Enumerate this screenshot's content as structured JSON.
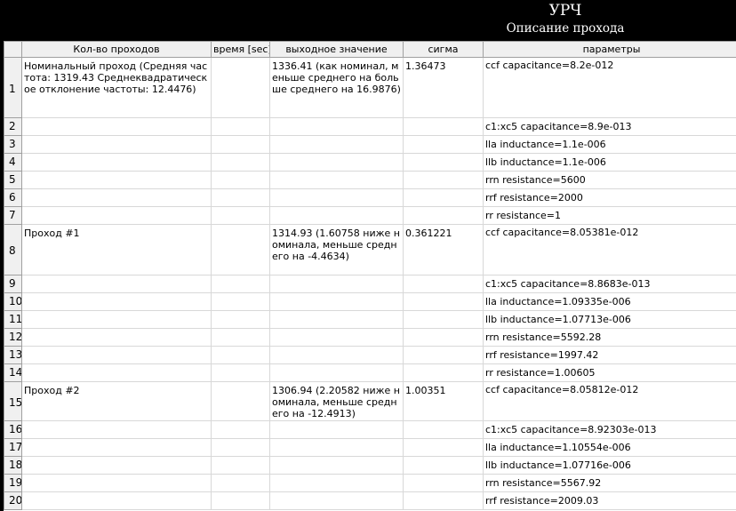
{
  "window": {
    "title": "УРЧ",
    "subtitle": "Описание прохода"
  },
  "columns": [
    "",
    "Кол-во проходов",
    "время [sec]",
    "выходное значение",
    "сигма",
    "параметры"
  ],
  "rows": [
    {
      "num": "1",
      "pass": "Номинальный проход (Средняя частота: 1319.43  Среднеквадратическое отклонение частоты: 12.4476)",
      "time": "",
      "output": "1336.41 (как номинал, меньше среднего на  больше среднего на 16.9876)",
      "sigma": "1.36473",
      "param": "ccf capacitance=8.2e-012"
    },
    {
      "num": "2",
      "pass": "",
      "time": "",
      "output": "",
      "sigma": "",
      "param": "c1:xc5 capacitance=8.9e-013"
    },
    {
      "num": "3",
      "pass": "",
      "time": "",
      "output": "",
      "sigma": "",
      "param": "lla inductance=1.1e-006"
    },
    {
      "num": "4",
      "pass": "",
      "time": "",
      "output": "",
      "sigma": "",
      "param": "llb inductance=1.1e-006"
    },
    {
      "num": "5",
      "pass": "",
      "time": "",
      "output": "",
      "sigma": "",
      "param": "rrn resistance=5600"
    },
    {
      "num": "6",
      "pass": "",
      "time": "",
      "output": "",
      "sigma": "",
      "param": "rrf resistance=2000"
    },
    {
      "num": "7",
      "pass": "",
      "time": "",
      "output": "",
      "sigma": "",
      "param": "rr resistance=1"
    },
    {
      "num": "8",
      "pass": "Проход #1",
      "time": "",
      "output": "1314.93 (1.60758 ниже номинала, меньше среднего на -4.4634)",
      "sigma": "0.361221",
      "param": "ccf capacitance=8.05381e-012"
    },
    {
      "num": "9",
      "pass": "",
      "time": "",
      "output": "",
      "sigma": "",
      "param": "c1:xc5 capacitance=8.8683e-013"
    },
    {
      "num": "10",
      "pass": "",
      "time": "",
      "output": "",
      "sigma": "",
      "param": "lla inductance=1.09335e-006"
    },
    {
      "num": "11",
      "pass": "",
      "time": "",
      "output": "",
      "sigma": "",
      "param": "llb inductance=1.07713e-006"
    },
    {
      "num": "12",
      "pass": "",
      "time": "",
      "output": "",
      "sigma": "",
      "param": "rrn resistance=5592.28"
    },
    {
      "num": "13",
      "pass": "",
      "time": "",
      "output": "",
      "sigma": "",
      "param": "rrf resistance=1997.42"
    },
    {
      "num": "14",
      "pass": "",
      "time": "",
      "output": "",
      "sigma": "",
      "param": "rr resistance=1.00605"
    },
    {
      "num": "15",
      "pass": "Проход #2",
      "time": "",
      "output": "1306.94 (2.20582 ниже номинала, меньше среднего на -12.4913)",
      "sigma": "1.00351",
      "param": "ccf capacitance=8.05812e-012"
    },
    {
      "num": "16",
      "pass": "",
      "time": "",
      "output": "",
      "sigma": "",
      "param": "c1:xc5 capacitance=8.92303e-013"
    },
    {
      "num": "17",
      "pass": "",
      "time": "",
      "output": "",
      "sigma": "",
      "param": "lla inductance=1.10554e-006"
    },
    {
      "num": "18",
      "pass": "",
      "time": "",
      "output": "",
      "sigma": "",
      "param": "llb inductance=1.07716e-006"
    },
    {
      "num": "19",
      "pass": "",
      "time": "",
      "output": "",
      "sigma": "",
      "param": "rrn resistance=5567.92"
    },
    {
      "num": "20",
      "pass": "",
      "time": "",
      "output": "",
      "sigma": "",
      "param": "rrf resistance=2009.03"
    }
  ]
}
